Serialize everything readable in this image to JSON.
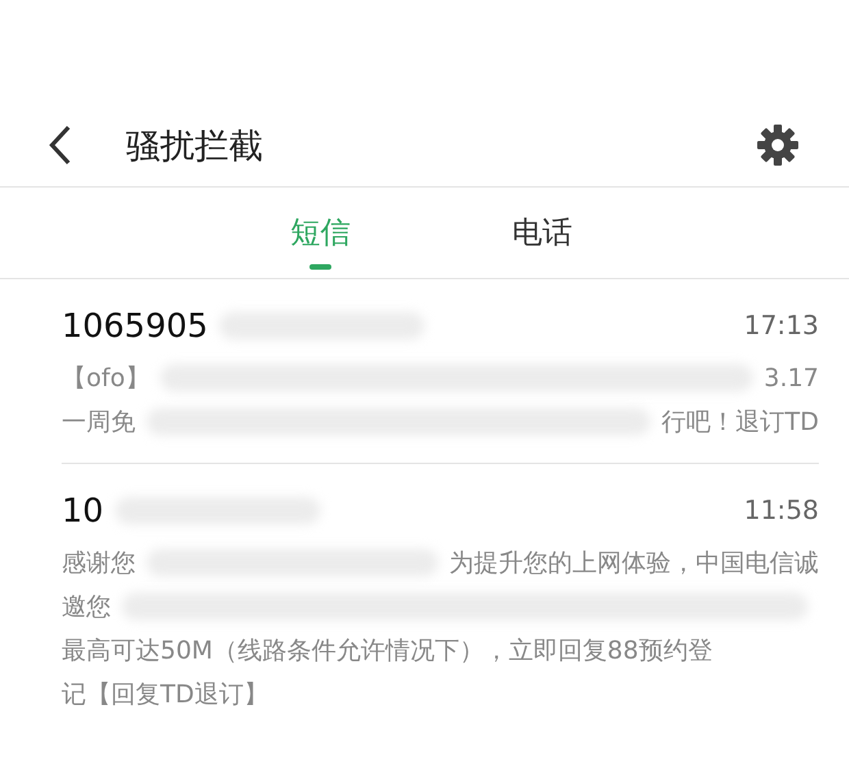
{
  "header": {
    "title": "骚扰拦截"
  },
  "tabs": [
    {
      "label": "短信",
      "selected": true
    },
    {
      "label": "电话",
      "selected": false
    }
  ],
  "messages": [
    {
      "sender": "1065905",
      "time": "17:13",
      "lines": [
        [
          "【ofo】",
          "3.17"
        ],
        [
          "一周免",
          "行吧！退订TD"
        ]
      ]
    },
    {
      "sender": "10",
      "time": "11:58",
      "lines": [
        [
          "感谢您",
          "为提升您的上网体验，中国电信诚"
        ],
        [
          "邀您"
        ],
        [
          "最高可达50M（线路条件允许情况下），立即回复88预约登"
        ],
        [
          "记【回复TD退订】"
        ]
      ]
    }
  ]
}
